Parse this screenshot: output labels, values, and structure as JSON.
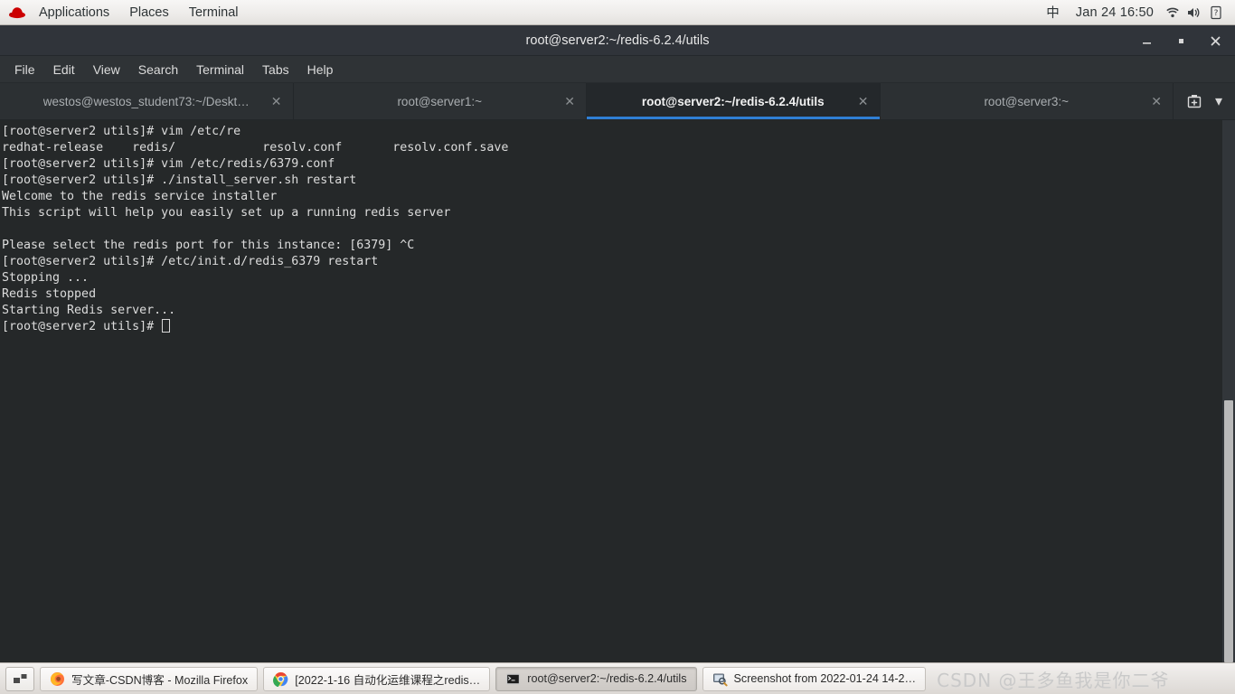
{
  "top_panel": {
    "logo_icon": "redhat-logo-icon",
    "menus": [
      "Applications",
      "Places",
      "Terminal"
    ],
    "input_method": "中",
    "clock": "Jan 24 16:50",
    "status_icons": [
      "wifi-icon",
      "volume-icon",
      "battery-unknown-icon"
    ]
  },
  "window": {
    "title": "root@server2:~/redis-6.2.4/utils",
    "controls": {
      "minimize": "—",
      "maximize": "▫",
      "close": "✕"
    },
    "menubar": [
      "File",
      "Edit",
      "View",
      "Search",
      "Terminal",
      "Tabs",
      "Help"
    ],
    "tabs": [
      {
        "label": "westos@westos_student73:~/Deskt…",
        "active": false,
        "close": "✕"
      },
      {
        "label": "root@server1:~",
        "active": false,
        "close": "✕"
      },
      {
        "label": "root@server2:~/redis-6.2.4/utils",
        "active": true,
        "close": "✕"
      },
      {
        "label": "root@server3:~",
        "active": false,
        "close": "✕"
      }
    ],
    "tab_actions": {
      "new_tab": "new-tab-icon",
      "tab_list": "▾"
    }
  },
  "terminal": {
    "background": "#252829",
    "foreground": "#dcdcdc",
    "accent": "#2f7fd4",
    "lines": [
      "[root@server2 utils]# vim /etc/re",
      "redhat-release    redis/            resolv.conf       resolv.conf.save",
      "[root@server2 utils]# vim /etc/redis/6379.conf",
      "[root@server2 utils]# ./install_server.sh restart",
      "Welcome to the redis service installer",
      "This script will help you easily set up a running redis server",
      "",
      "Please select the redis port for this instance: [6379] ^C",
      "[root@server2 utils]# /etc/init.d/redis_6379 restart",
      "Stopping ...",
      "Redis stopped",
      "Starting Redis server...",
      "[root@server2 utils]# "
    ]
  },
  "taskbar": {
    "workspace_switcher": "workspace-switcher-icon",
    "tasks": [
      {
        "icon": "firefox-icon",
        "label": "写文章-CSDN博客 - Mozilla Firefox",
        "active": false
      },
      {
        "icon": "chrome-icon",
        "label": "[2022-1-16 自动化运维课程之redis…",
        "active": false
      },
      {
        "icon": "terminal-icon",
        "label": "root@server2:~/redis-6.2.4/utils",
        "active": true
      },
      {
        "icon": "screenshot-icon",
        "label": "Screenshot from 2022-01-24 14-2…",
        "active": false
      }
    ],
    "watermark": "CSDN @王多鱼我是你二爷"
  }
}
